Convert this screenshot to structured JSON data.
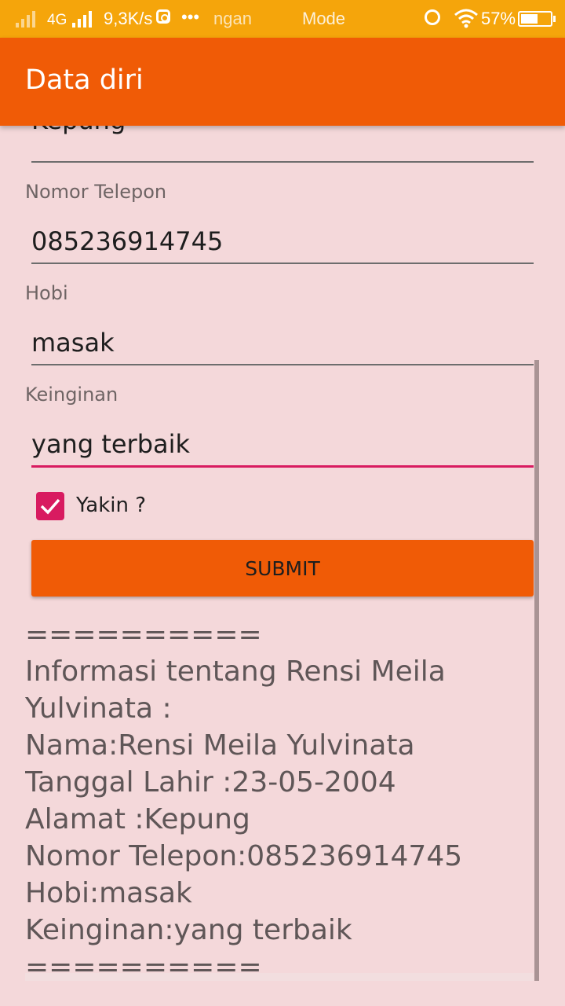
{
  "status_bar": {
    "network": "4G",
    "speed": "9,3K/s",
    "dots": "•••",
    "ticker_1": "ngan",
    "ticker_2": "Mode",
    "battery": "57%",
    "battery_level": 0.57
  },
  "app_bar": {
    "title": "Data diri"
  },
  "form": {
    "previous_value": "Kepung",
    "phone_label": "Nomor Telepon",
    "phone_value": "085236914745",
    "hobby_label": "Hobi",
    "hobby_value": "masak",
    "wish_label": "Keinginan",
    "wish_value": "yang terbaik",
    "confirm_label": "Yakin ?",
    "confirm_checked": true,
    "submit_label": "SUBMIT"
  },
  "output": {
    "lines": [
      "==========",
      "Informasi tentang Rensi Meila",
      "Yulvinata :",
      "Nama:Rensi Meila Yulvinata",
      "Tanggal Lahir :23-05-2004",
      "Alamat  :Kepung",
      "Nomor Telepon:085236914745",
      "Hobi:masak",
      "Keinginan:yang terbaik",
      "=========="
    ]
  },
  "colors": {
    "status_bar": "#f5a50b",
    "app_bar": "#f05b06",
    "background": "#f4d8da",
    "accent": "#d81b60"
  }
}
